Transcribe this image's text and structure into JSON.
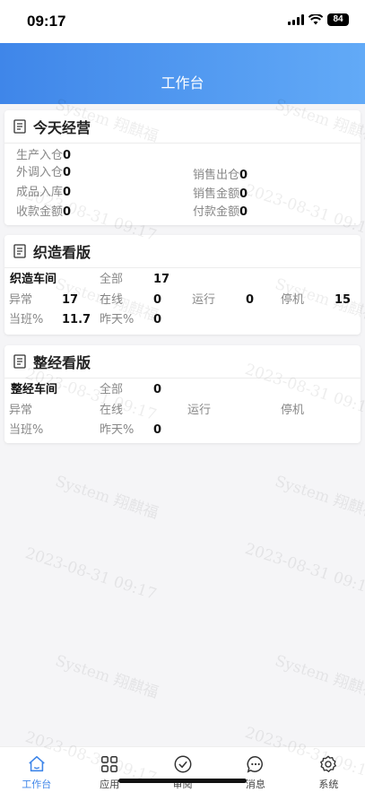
{
  "status_bar": {
    "time": "09:17",
    "battery": "84"
  },
  "header": {
    "title": "工作台"
  },
  "today_ops": {
    "title": "今天经营",
    "rows": [
      [
        {
          "label": "生产入仓",
          "value": "0"
        }
      ],
      [
        {
          "label": "外调入仓",
          "value": "0"
        },
        {
          "label": "销售出仓",
          "value": "0"
        }
      ],
      [
        {
          "label": "成品入库",
          "value": "0"
        },
        {
          "label": "销售金额",
          "value": "0"
        }
      ],
      [
        {
          "label": "收款金额",
          "value": "0"
        },
        {
          "label": "付款金额",
          "value": "0"
        }
      ]
    ]
  },
  "weaving": {
    "title": "织造看版",
    "workshop": "织造车间",
    "all_label": "全部",
    "all_value": "17",
    "abnormal_label": "异常",
    "abnormal_value": "17",
    "online_label": "在线",
    "online_value": "0",
    "running_label": "运行",
    "running_value": "0",
    "stopped_label": "停机",
    "stopped_value": "15",
    "shift_label": "当班%",
    "shift_value": "11.7",
    "yesterday_label": "昨天%",
    "yesterday_value": "0"
  },
  "warping": {
    "title": "整经看版",
    "workshop": "整经车间",
    "all_label": "全部",
    "all_value": "0",
    "abnormal_label": "异常",
    "online_label": "在线",
    "running_label": "运行",
    "stopped_label": "停机",
    "shift_label": "当班%",
    "yesterday_label": "昨天%",
    "yesterday_value": "0"
  },
  "watermark": {
    "line1": "System 翔麒福",
    "line2": "2023-08-31 09:17"
  },
  "tabs": [
    {
      "label": "工作台",
      "icon": "home-icon"
    },
    {
      "label": "应用",
      "icon": "grid-icon"
    },
    {
      "label": "审阅",
      "icon": "check-circle-icon"
    },
    {
      "label": "消息",
      "icon": "chat-icon"
    },
    {
      "label": "系统",
      "icon": "gear-icon"
    }
  ],
  "colors": {
    "accent": "#3f86e9",
    "header_gradient_end": "#62aaf7"
  }
}
